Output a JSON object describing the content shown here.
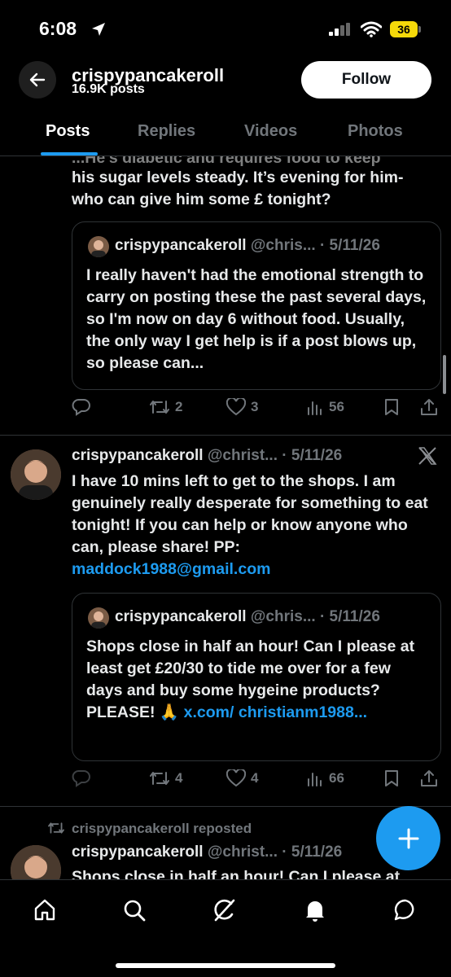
{
  "status_bar": {
    "time": "6:08",
    "battery": "36"
  },
  "header": {
    "name": "crispypancakeroll",
    "posts_count": "16.9K posts",
    "follow_label": "Follow"
  },
  "tabs": [
    {
      "label": "Posts",
      "active": true
    },
    {
      "label": "Replies",
      "active": false
    },
    {
      "label": "Videos",
      "active": false
    },
    {
      "label": "Photos",
      "active": false
    }
  ],
  "post1": {
    "text_partial_top": "...He's diabetic and requires food to keep",
    "text_line2": "his sugar levels steady. It’s evening for him-",
    "text_line3": "who can give him some £ tonight?",
    "quote": {
      "name": "crispypancakeroll",
      "handle": "@chris...",
      "date": "· 5/11/26",
      "text": "I really haven't had the emotional strength to carry on posting these the past several days, so I'm now on day 6 without food. Usually, the only way I get help is if a post blows up, so please can..."
    },
    "actions": {
      "reposts": "2",
      "likes": "3",
      "views": "56"
    }
  },
  "post2": {
    "name": "crispypancakeroll",
    "handle": "@christ...",
    "date": "· 5/11/26",
    "text": "I have 10 mins left to get to the shops. I am genuinely really desperate for something to eat tonight! If you can help or know anyone who can, please share! PP:",
    "email": "maddock1988@gmail.com",
    "quote": {
      "name": "crispypancakeroll",
      "handle": "@chris...",
      "date": "· 5/11/26",
      "text": "Shops close in half an hour! Can I please at least get £20/30 to tide me over for a few days and buy some hygeine products? PLEASE! 🙏",
      "link1": "x.com/",
      "link2": "christianm1988..."
    },
    "actions": {
      "reposts": "4",
      "likes": "4",
      "views": "66"
    }
  },
  "post3": {
    "repost_label": "crispypancakeroll reposted",
    "name": "crispypancakeroll",
    "handle": "@christ...",
    "date": "· 5/11/26",
    "text": "Shops close in half an hour! Can I please at"
  },
  "icons": {
    "back": "back-arrow-icon",
    "reply": "reply-icon",
    "repost": "repost-icon",
    "like": "heart-icon",
    "views": "views-icon",
    "bookmark": "bookmark-icon",
    "share": "share-icon",
    "compose": "compose-plus-icon",
    "x_logo": "x-logo-icon",
    "home": "home-icon",
    "search": "search-icon",
    "grok": "grok-icon",
    "notifications": "bell-icon",
    "messages": "messages-icon"
  },
  "colors": {
    "accent": "#1d9bf0",
    "background": "#000000",
    "muted": "#71767b",
    "battery": "#f5d90a"
  }
}
